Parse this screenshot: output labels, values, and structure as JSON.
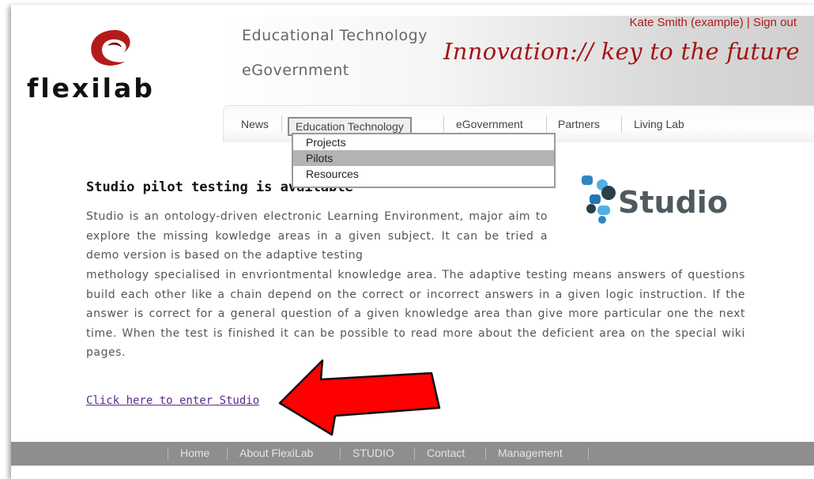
{
  "brand": {
    "logo_text": "flexilab"
  },
  "header": {
    "section_links": [
      "Educational Technology",
      "eGovernment"
    ],
    "user_name": "Kate Smith (example)",
    "separator": "|",
    "sign_out": "Sign out",
    "tagline": "Innovation:// key to the future"
  },
  "nav": {
    "items": [
      "News",
      "Education Technology",
      "eGovernment",
      "Partners",
      "Living Lab"
    ],
    "active_index": 1
  },
  "dropdown": {
    "items": [
      "Projects",
      "Pilots",
      "Resources"
    ],
    "hover_index": 1
  },
  "main": {
    "title": "Studio pilot testing is available",
    "studio_logo_text": "Studio",
    "para_top": "Studio is an ontology-driven electronic Learning Environment, major aim to explore the missing kowledge areas in a given subject. It can be tried a demo version is based on the adaptive testing",
    "para_bottom": "methology specialised in envriontmental knowledge area. The adaptive testing means answers of questions build each other like a chain depend on the correct or incorrect answers in a given logic instruction. If the answer is correct for a general question of a given knowledge area than give more particular one the next time. When the test is finished it can be possible to read more about the deficient area on the special wiki pages.",
    "enter_link": "Click here to enter Studio"
  },
  "footer": {
    "items": [
      "Home",
      "About FlexiLab",
      "STUDIO",
      "Contact",
      "Management"
    ]
  },
  "colors": {
    "brand_red": "#a31515",
    "link_purple": "#5e2a8a",
    "footer_bg": "#8e8e8e",
    "arrow_red": "#ff0000"
  },
  "icons": {
    "studio_logo": "studio-dots-logo",
    "annotation": "red-arrow"
  }
}
